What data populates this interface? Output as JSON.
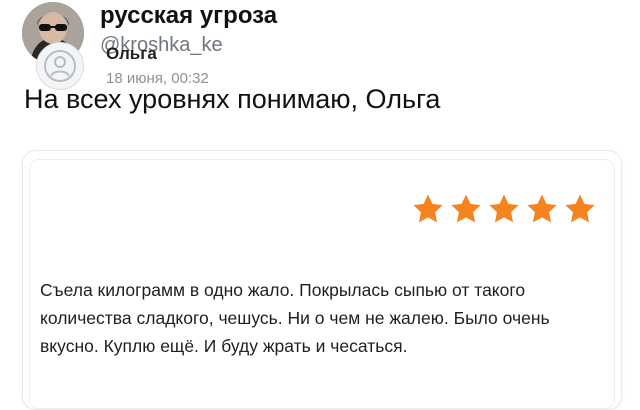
{
  "tweet": {
    "display_name": "русская угроза",
    "handle": "@kroshka_ke",
    "text": "На всех уровнях понимаю, Ольга"
  },
  "review": {
    "author": "Ольга",
    "date": "18 июня, 00:32",
    "rating": 5,
    "rating_max": 5,
    "star_color": "#f5831f",
    "text": "Съела килограмм в одно жало. Покрылась сыпью от такого количества сладкого, чешусь. Ни о чем не жалею. Было очень вкусно. Куплю ещё. И буду жрать и чесаться."
  },
  "colors": {
    "handle": "#6e7680",
    "card_border": "#e6e8ec",
    "star": "#f5831f"
  },
  "icons": {
    "user_placeholder": "user-icon",
    "rating": "star-icon"
  }
}
